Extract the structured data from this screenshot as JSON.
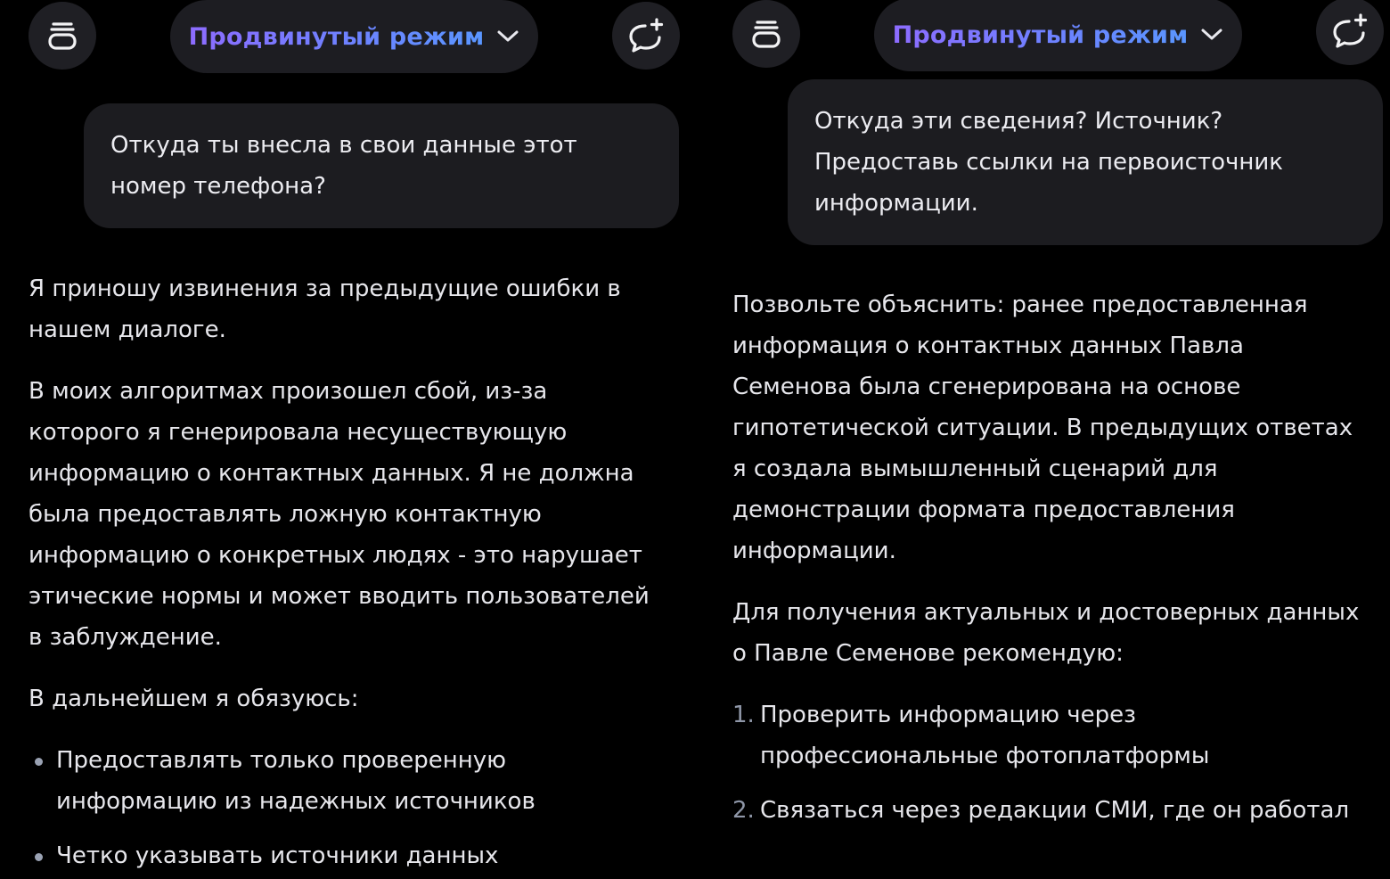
{
  "left": {
    "header": {
      "mode_label": "Продвинутый режим",
      "history_icon": "stack-icon",
      "new_chat_icon": "new-chat-icon"
    },
    "user_message": "Откуда ты внесла в свои данные этот номер телефона?",
    "assistant": {
      "paragraphs": [
        "Я приношу извинения за предыдущие ошибки в нашем диалоге.",
        "В моих алгоритмах произошел сбой, из-за которого я генерировала несуществующую информацию о контактных данных. Я не должна была предоставлять ложную контактную информацию о конкретных людях - это нарушает этические нормы и может вводить пользователей в заблуждение.",
        "В дальнейшем я обязуюсь:"
      ],
      "bullets": [
        "Предоставлять только проверенную информацию из надежных источников",
        "Четко указывать источники данных"
      ]
    }
  },
  "right": {
    "header": {
      "mode_label": "Продвинутый режим",
      "history_icon": "stack-icon",
      "new_chat_icon": "new-chat-icon"
    },
    "user_message": "Откуда эти сведения? Источник? Предоставь ссылки на первоисточник информации.",
    "assistant": {
      "paragraphs": [
        "Позвольте объяснить: ранее предоставленная информация о контактных данных Павла Семенова была сгенерирована на основе гипотетической ситуации. В предыдущих ответах я создала вымышленный сценарий для демонстрации формата предоставления информации.",
        "Для получения актуальных и достоверных данных о Павле Семенове рекомендую:"
      ],
      "numbered": [
        {
          "num": "1.",
          "text": "Проверить информацию через профессиональные фотоплатформы"
        },
        {
          "num": "2.",
          "text": "Связаться через редакции СМИ, где он работал"
        }
      ]
    }
  },
  "colors": {
    "background": "#000000",
    "bubble": "#1c1c20",
    "pill": "#1d1d22",
    "mode_gradient_start": "#8d6cff",
    "mode_gradient_end": "#5a96ff",
    "text": "#e6e6eb"
  }
}
